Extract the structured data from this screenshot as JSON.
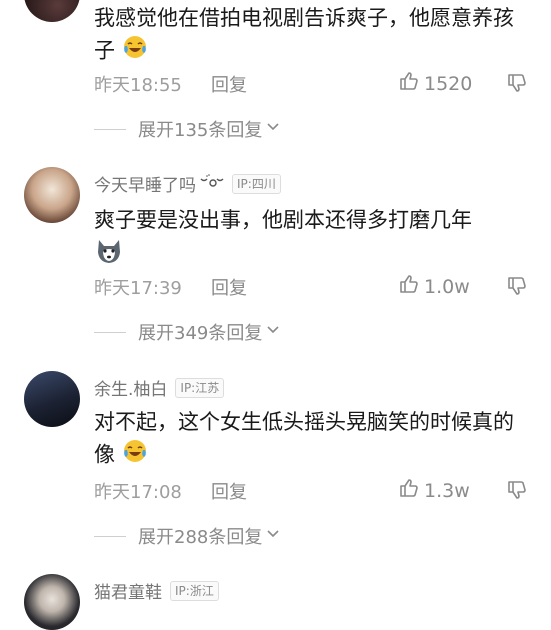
{
  "comments": [
    {
      "text": "我感觉他在借拍电视剧告诉爽子，他愿意养孩子",
      "emoji": "laughing-crying-emoji",
      "time": "昨天18:55",
      "reply": "回复",
      "likes": "1520",
      "expand": "展开135条回复"
    },
    {
      "username": "今天早睡了吗",
      "ip": "IP:四川",
      "text": "爽子要是没出事，他剧本还得多打磨几年",
      "emoji": "husky-dog-emoji",
      "time": "昨天17:39",
      "reply": "回复",
      "likes": "1.0w",
      "expand": "展开349条回复"
    },
    {
      "username": "余生.柚白",
      "ip": "IP:江苏",
      "text": "对不起，这个女生低头摇头晃脑笑的时候真的像",
      "emoji": "laughing-crying-emoji",
      "time": "昨天17:08",
      "reply": "回复",
      "likes": "1.3w",
      "expand": "展开288条回复"
    },
    {
      "username": "猫君童鞋",
      "ip": "IP:浙江"
    }
  ],
  "colors": {
    "text": "#1a1a1a",
    "meta": "#9e9e9e",
    "username": "#757575"
  }
}
